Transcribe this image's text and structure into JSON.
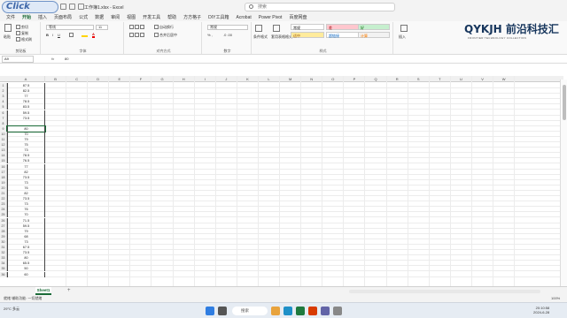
{
  "titlebar": {
    "badge": "Click",
    "document_title": "工作簿1.xlsx - Excel",
    "search_placeholder": "搜索"
  },
  "menu": [
    "文件",
    "开始",
    "插入",
    "页面布局",
    "公式",
    "数据",
    "审阅",
    "视图",
    "开发工具",
    "帮助",
    "方方格子",
    "DIY工具箱",
    "Acrobat",
    "Power Pivot",
    "百度网盘"
  ],
  "menu_active_index": 1,
  "ribbon": {
    "clipboard": {
      "label": "剪贴板",
      "paste": "粘贴",
      "cut": "剪切",
      "copy": "复制",
      "format_painter": "格式刷"
    },
    "font": {
      "label": "字体",
      "font_name": "等线",
      "font_size": "11"
    },
    "alignment": {
      "label": "对齐方式",
      "wrap": "自动换行",
      "merge": "合并后居中"
    },
    "number": {
      "label": "数字",
      "format": "常规"
    },
    "styles": {
      "label": "样式",
      "conditional": "条件格式",
      "table_format": "套用表格格式",
      "cells": [
        {
          "text": "常规",
          "bg": "#ffffff",
          "color": "#222222"
        },
        {
          "text": "差",
          "bg": "#ffc7ce",
          "color": "#9c0006"
        },
        {
          "text": "好",
          "bg": "#c6efce",
          "color": "#006100"
        },
        {
          "text": "适中",
          "bg": "#ffeb9c",
          "color": "#9c5700"
        },
        {
          "text": "超链接",
          "bg": "#ffffff",
          "color": "#0563c1"
        },
        {
          "text": "计算",
          "bg": "#f2f2f2",
          "color": "#fa7d00"
        }
      ]
    },
    "insert": "插入"
  },
  "logo": {
    "main": "QYKJH 前沿科技汇",
    "sub": "FRONTIER TECHNOLOGY COLLECTION"
  },
  "formula": {
    "name_box": "A9",
    "fx": "fx",
    "value": "80"
  },
  "columns": [
    "A",
    "B",
    "C",
    "D",
    "E",
    "F",
    "G",
    "H",
    "I",
    "J",
    "K",
    "L",
    "M",
    "N",
    "O",
    "P",
    "Q",
    "R",
    "S",
    "T",
    "U",
    "V",
    "W"
  ],
  "rows": [
    {
      "n": "1",
      "a": "87.5"
    },
    {
      "n": "2",
      "a": "82.5"
    },
    {
      "n": "3",
      "a": "77"
    },
    {
      "n": "4",
      "a": "78.5"
    },
    {
      "n": "5",
      "a": "83.5"
    },
    {
      "n": "6",
      "a": "59.5"
    },
    {
      "n": "7",
      "a": "73.5"
    },
    {
      "n": "8",
      "a": ""
    },
    {
      "n": "9",
      "a": "80"
    },
    {
      "n": "10",
      "a": "70"
    },
    {
      "n": "11",
      "a": "79"
    },
    {
      "n": "12",
      "a": "75"
    },
    {
      "n": "13",
      "a": "73"
    },
    {
      "n": "14",
      "a": "78.5"
    },
    {
      "n": "15",
      "a": "76.5"
    },
    {
      "n": "16",
      "a": "77"
    },
    {
      "n": "17",
      "a": "82"
    },
    {
      "n": "18",
      "a": "73.5"
    },
    {
      "n": "19",
      "a": "73"
    },
    {
      "n": "20",
      "a": "76"
    },
    {
      "n": "21",
      "a": "82"
    },
    {
      "n": "22",
      "a": "73.5"
    },
    {
      "n": "23",
      "a": "73"
    },
    {
      "n": "24",
      "a": "76"
    },
    {
      "n": "25",
      "a": "70"
    },
    {
      "n": "26",
      "a": "71.5"
    },
    {
      "n": "27",
      "a": "59.5"
    },
    {
      "n": "28",
      "a": "79"
    },
    {
      "n": "29",
      "a": "68"
    },
    {
      "n": "30",
      "a": "73"
    },
    {
      "n": "31",
      "a": "67.5"
    },
    {
      "n": "32",
      "a": "73.5"
    },
    {
      "n": "33",
      "a": "80"
    },
    {
      "n": "34",
      "a": "65.5"
    },
    {
      "n": "35",
      "a": "50"
    },
    {
      "n": "36",
      "a": "60"
    }
  ],
  "sheet": {
    "tab": "Sheet1",
    "add": "+"
  },
  "status": {
    "left": "就绪    辅助功能: 一切就绪",
    "zoom": "100%"
  },
  "taskbar": {
    "search": "搜索",
    "time": "20:10:58",
    "date": "2024-6-28",
    "weather": "29°C 多云"
  }
}
